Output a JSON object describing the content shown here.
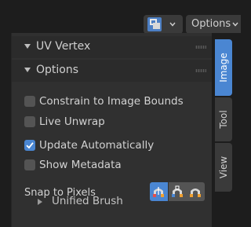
{
  "header": {
    "mode_icon": "image-editor-icon",
    "options_label": "Options"
  },
  "panel": {
    "sections": [
      {
        "label": "UV Vertex",
        "expanded": true
      },
      {
        "label": "Options",
        "expanded": true
      }
    ],
    "checkboxes": [
      {
        "label": "Constrain to Image Bounds",
        "checked": false
      },
      {
        "label": "Live Unwrap",
        "checked": false
      },
      {
        "label": "Update Automatically",
        "checked": true
      },
      {
        "label": "Show Metadata",
        "checked": false
      }
    ],
    "snap": {
      "label": "Snap to Pixels",
      "options": [
        "snap-pixels-icon",
        "snap-corner-icon",
        "snap-off-icon"
      ],
      "active_index": 0
    },
    "subpanel": {
      "label": "Unified Brush",
      "expanded": false
    }
  },
  "tabs": [
    {
      "label": "Image",
      "active": true
    },
    {
      "label": "Tool",
      "active": false
    },
    {
      "label": "View",
      "active": false
    }
  ],
  "colors": {
    "accent": "#4a86d2",
    "panel_bg": "#303030",
    "header_bg": "#2b2b2b",
    "window_bg": "#1d1d1d"
  }
}
